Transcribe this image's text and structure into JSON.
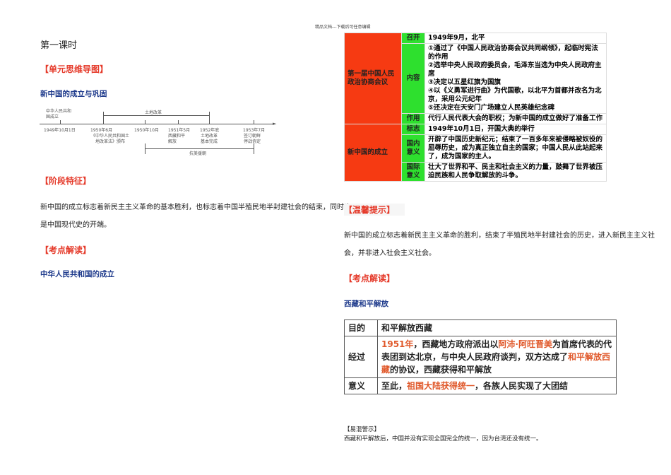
{
  "header": "精品文档---下载后可任意编辑",
  "left": {
    "lesson": "第一课时",
    "mindmap": "【单元思维导图】",
    "mindmap_title": "新中国的成立与巩固",
    "timeline": {
      "founding_label": "中华人民共和国成立",
      "land_reform": "土地改革",
      "resist": "抗美援朝",
      "events": [
        {
          "date": "1949年10月1日",
          "desc": ""
        },
        {
          "date": "1950年6月",
          "desc": "《中华人民共和国土地改革法》颁布"
        },
        {
          "date": "1950年10月",
          "desc": ""
        },
        {
          "date": "1951年5月",
          "desc": "西藏和平解放"
        },
        {
          "date": "1952年底",
          "desc": "土地改革基本完成"
        },
        {
          "date": "1953年7月",
          "desc": "签订朝鲜停战协定"
        }
      ]
    },
    "stage": "【阶段特征】",
    "stage_text1": "新中国的成立标志着新民主主义革命的基本胜利，也标志着中国半殖民地半封建社会的结束，同时也",
    "stage_text2": "是中国现代史的开端。",
    "kaodian": "【考点解读】",
    "kaodian_title": "中华人民共和国的成立"
  },
  "table1": {
    "group1": "第一届中国人民政治协商会议",
    "r1_label": "召开",
    "r1": "1949年9月，北平",
    "r2_label": "内容",
    "r2": [
      "①通过了《中国人民政治协商会议共同纲领》，起临时宪法的作用",
      "②选举中央人民政府委员会，毛泽东当选为中央人民政府主席",
      "③决定以五星红旗为国旗",
      "④以《义勇军进行曲》为代国歌，以北平为首都并改名为北京，采用公元纪年",
      "⑤还决定在天安门广场建立人民英雄纪念碑"
    ],
    "r3_label": "作用",
    "r3": "代行人民代表大会的职权；为新中国的成立做好了准备工作",
    "group2": "新中国的成立",
    "r4_label": "标志",
    "r4": "1949年10月1日，开国大典的举行",
    "r5_label": "国内意义",
    "r5": "开辟了中国历史新纪元；结束了一百多年来被侵略被奴役的屈辱历史，成为真正独立自主的国家；中国人民从此站起来了，成为国家的主人。",
    "r6_label": "国际意义",
    "r6": "壮大了世界和平、民主和社会主义的力量，鼓舞了世界被压迫民族和人民争取解放的斗争。"
  },
  "right": {
    "tip": "【温馨提示】",
    "tip_text1": "新中国的成立标志着新民主主义革命的胜利，结束了半殖民地半封建社会的历史，进入新民主主义社",
    "tip_text2": "会，并非进入社会主义社会。",
    "kaodian": "【考点解读】",
    "kaodian_title": "西藏和平解放",
    "confuse": "【易混警示】",
    "confuse_text": "西藏和平解放后，中国并没有实现全国完全的统一，因为台湾还没有统一。"
  },
  "table2": {
    "r1_label": "目的",
    "r1": "和平解放西藏",
    "r2_label": "经过",
    "r2_a": "1951年",
    "r2_b": "，西藏地方政府派出以",
    "r2_c": "阿沛·阿旺晋美",
    "r2_d": "为首席代表的代表团到达北京，与中央人民政府谈判，双方达成了",
    "r2_e": "和平解放西藏",
    "r2_f": "的协议，西藏获得和平解放",
    "r3_label": "意义",
    "r3_a": "至此，",
    "r3_b": "祖国大陆获得统一",
    "r3_c": "，各族人民实现了大团结"
  }
}
